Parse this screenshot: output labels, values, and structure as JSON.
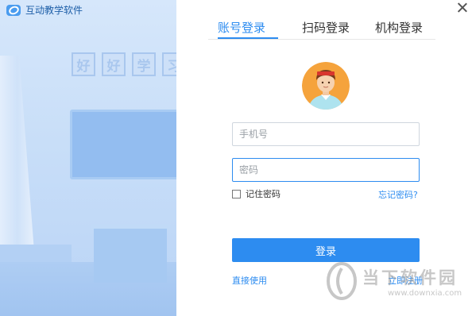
{
  "app": {
    "title": "互动教学软件",
    "logo_icon": "app-logo-icon"
  },
  "illustration": {
    "wall_signs": [
      "好",
      "好",
      "学",
      "习"
    ]
  },
  "tabs": [
    {
      "label": "账号登录",
      "active": true
    },
    {
      "label": "扫码登录",
      "active": false
    },
    {
      "label": "机构登录",
      "active": false
    }
  ],
  "form": {
    "phone_placeholder": "手机号",
    "password_placeholder": "密码",
    "remember_label": "记住密码",
    "remember_checked": false,
    "forgot_label": "忘记密码?",
    "login_label": "登录",
    "direct_use_label": "直接使用",
    "register_label": "立即注册"
  },
  "watermark": {
    "name": "当下软件园",
    "url": "www.downxia.com"
  },
  "colors": {
    "accent": "#2d8cf0",
    "panel": "#c8def8",
    "avatar_bg": "#f5a33c"
  }
}
